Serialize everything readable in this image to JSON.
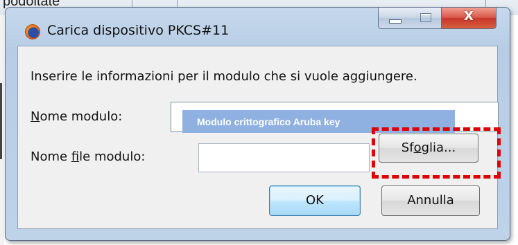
{
  "background": {
    "text": "podoltate"
  },
  "dialog": {
    "title": "Carica dispositivo PKCS#11",
    "title_icon": "firefox-icon",
    "controls": {
      "minimize_icon": "minimize-icon",
      "maximize_icon": "maximize-icon",
      "close_glyph": "X"
    }
  },
  "form": {
    "instruction": "Inserire le informazioni per il modulo che si vuole aggiungere.",
    "module_name": {
      "label_before": "",
      "label_underlined": "N",
      "label_after": "ome modulo:",
      "value": "Modulo crittografico Aruba key"
    },
    "module_file": {
      "label_before": "Nome ",
      "label_underlined": "f",
      "label_after": "ile modulo:",
      "value": ""
    },
    "browse": {
      "label_before": "Sf",
      "label_underlined": "o",
      "label_after": "glia..."
    },
    "ok_label": "OK",
    "cancel_label": "Annulla"
  },
  "colors": {
    "highlight": "#8fb1e1",
    "annotation": "#e00000"
  }
}
